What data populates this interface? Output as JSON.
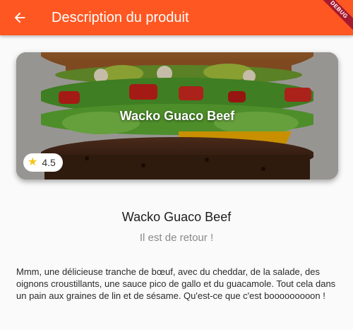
{
  "appbar": {
    "title": "Description du produit",
    "back_icon": "arrow-back-icon",
    "color": "#ff5722"
  },
  "debug_banner": "DEBUG",
  "card": {
    "title": "Wacko Guaco Beef",
    "rating": "4.5",
    "rating_icon": "star-icon"
  },
  "product": {
    "name": "Wacko Guaco Beef",
    "subtitle": "Il est de retour !",
    "description": "Mmm, une délicieuse tranche de bœuf, avec du cheddar, de la salade, des oignons croustillants, une sauce pico de gallo et du guacamole. Tout cela dans un pain aux graines de lin et de sésame. Qu'est-ce que c'est booooooooon !"
  }
}
